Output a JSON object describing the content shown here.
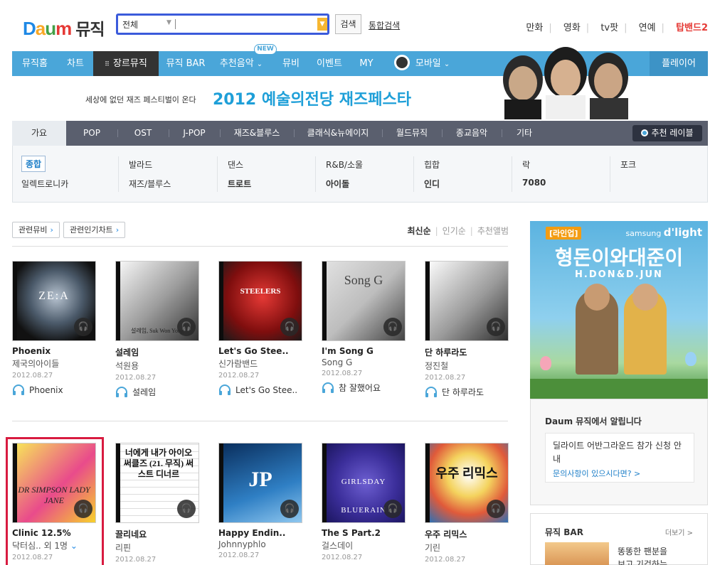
{
  "header": {
    "logo": "Daum",
    "logo_service": "뮤직",
    "search_scope": "전체",
    "search_value": "",
    "search_button": "검색",
    "integrated_search": "통합검색",
    "links": [
      "만화",
      "영화",
      "tv팟",
      "연예"
    ],
    "hot_link": "탑밴드2"
  },
  "nav": {
    "items": [
      "뮤직홈",
      "차트",
      "장르뮤직",
      "뮤직 BAR",
      "추천음악",
      "뮤비",
      "이벤트",
      "MY",
      "모바일"
    ],
    "new_badge": "NEW",
    "player": "플레이어"
  },
  "banner": {
    "small_text": "세상에 없던 재즈 페스티벌이 온다",
    "big_text": "2012 예술의전당 재즈페스타"
  },
  "genre_tabs": [
    "가요",
    "POP",
    "OST",
    "J-POP",
    "재즈&블루스",
    "클래식&뉴에이지",
    "월드뮤직",
    "종교음악",
    "기타"
  ],
  "label_button": "추천 레이블",
  "sub_genres": [
    {
      "r1": "종합",
      "r2": "일렉트로니카"
    },
    {
      "r1": "발라드",
      "r2": "재즈/블루스"
    },
    {
      "r1": "댄스",
      "r2": "트로트"
    },
    {
      "r1": "R&B/소울",
      "r2": "아이돌"
    },
    {
      "r1": "힙합",
      "r2": "인디"
    },
    {
      "r1": "락",
      "r2": "7080"
    },
    {
      "r1": "포크",
      "r2": ""
    }
  ],
  "toolbar": {
    "related_mv": "관련뮤비",
    "related_chart": "관련인기차트",
    "sort": [
      "최신순",
      "인기순",
      "추천앨범"
    ]
  },
  "albums": [
    {
      "title": "Phoenix",
      "artist": "제국의아이들",
      "date": "2012.08.27",
      "song": "Phoenix",
      "cover_text": "ZE:A"
    },
    {
      "title": "설레임",
      "artist": "석원용",
      "date": "2012.08.27",
      "song": "설레임",
      "cover_text": "설레임, Suk Won Yong"
    },
    {
      "title": "Let's Go Stee..",
      "artist": "신가람밴드",
      "date": "2012.08.27",
      "song": "Let's Go Stee..",
      "cover_text": "STEELERS"
    },
    {
      "title": "I'm Song G",
      "artist": "Song G",
      "date": "2012.08.27",
      "song": "참 잘했어요",
      "cover_text": "Song G"
    },
    {
      "title": "단 하루라도",
      "artist": "정진철",
      "date": "2012.08.27",
      "song": "단 하루라도",
      "cover_text": ""
    },
    {
      "title": "Clinic 12.5%",
      "artist": "닥터심.. 외 1명",
      "date": "2012.08.27",
      "cover_text": "DR SIMPSON LADY JANE"
    },
    {
      "title": "끌리네요",
      "artist": "리핀",
      "date": "2012.08.27",
      "cover_text": "너에게 내가 아이오 써클즈 (21. 무직) 써스트 디너르"
    },
    {
      "title": "Happy Endin..",
      "artist": "Johnnyphlo",
      "date": "2012.08.27",
      "cover_text": "JP"
    },
    {
      "title": "The S Part.2",
      "artist": "걸스데이",
      "date": "2012.08.27",
      "cover_text": "GIRLSDAY BLUERAIN"
    },
    {
      "title": "우주 리믹스",
      "artist": "기린",
      "date": "2012.08.27",
      "cover_text": "우주 리믹스"
    }
  ],
  "ad": {
    "tag": "[라인업]",
    "brand_prefix": "samsung",
    "brand": "d'light",
    "headline": "형돈이와대준이",
    "sub": "H.DON&D.JUN"
  },
  "notice": {
    "title": "Daum 뮤직에서 알립니다",
    "text": "딜라이트 어반그라운드 참가 신청 안내",
    "link": "문의사항이 있으시다면? >"
  },
  "music_bar": {
    "title": "뮤직 BAR",
    "more": "더보기 >",
    "line1": "똥똥한 팬분을",
    "line2": "보고 기겁하는"
  },
  "colors": {
    "nav": "#4aa6d9",
    "genre_bar": "#5a5f6e",
    "highlight": "#d81b40",
    "accent_blue": "#1e88e5"
  }
}
